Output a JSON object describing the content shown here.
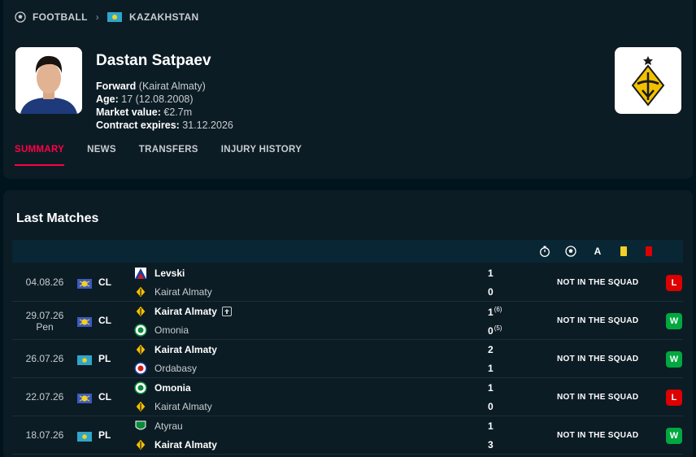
{
  "breadcrumb": {
    "sport": "FOOTBALL",
    "country": "KAZAKHSTAN"
  },
  "player": {
    "name": "Dastan Satpaev",
    "position_label": "Forward",
    "club_paren": "(Kairat Almaty)",
    "age_label": "Age:",
    "age_value": "17 (12.08.2008)",
    "market_label": "Market value:",
    "market_value": "€2.7m",
    "contract_label": "Contract expires:",
    "contract_value": "31.12.2026"
  },
  "tabs": [
    "SUMMARY",
    "NEWS",
    "TRANSFERS",
    "INJURY HISTORY"
  ],
  "matches": {
    "title": "Last Matches",
    "header_icons": [
      "stopwatch-icon",
      "ball-icon",
      "assist-icon",
      "yellow-card-icon",
      "red-card-icon"
    ],
    "header_assist_letter": "A",
    "rows": [
      {
        "date": "04.08.26",
        "note": "",
        "comp": "CL",
        "comp_flag": "europe",
        "home": "Levski",
        "home_bold": true,
        "home_score": "1",
        "home_pen": "",
        "home_logo": "levski",
        "away": "Kairat Almaty",
        "away_bold": false,
        "away_score": "0",
        "away_pen": "",
        "away_logo": "kairat",
        "status": "NOT IN THE SQUAD",
        "result": "L"
      },
      {
        "date": "29.07.26",
        "note": "Pen",
        "comp": "CL",
        "comp_flag": "europe",
        "home": "Kairat Almaty",
        "home_bold": true,
        "home_score": "1",
        "home_pen": "(6)",
        "home_logo": "kairat",
        "away": "Omonia",
        "away_bold": false,
        "away_score": "0",
        "away_pen": "(5)",
        "away_logo": "omonia",
        "status": "NOT IN THE SQUAD",
        "result": "W",
        "promoted": true
      },
      {
        "date": "26.07.26",
        "note": "",
        "comp": "PL",
        "comp_flag": "kazakhstan",
        "home": "Kairat Almaty",
        "home_bold": true,
        "home_score": "2",
        "home_pen": "",
        "home_logo": "kairat",
        "away": "Ordabasy",
        "away_bold": false,
        "away_score": "1",
        "away_pen": "",
        "away_logo": "ordabasy",
        "status": "NOT IN THE SQUAD",
        "result": "W"
      },
      {
        "date": "22.07.26",
        "note": "",
        "comp": "CL",
        "comp_flag": "europe",
        "home": "Omonia",
        "home_bold": true,
        "home_score": "1",
        "home_pen": "",
        "home_logo": "omonia",
        "away": "Kairat Almaty",
        "away_bold": false,
        "away_score": "0",
        "away_pen": "",
        "away_logo": "kairat",
        "status": "NOT IN THE SQUAD",
        "result": "L"
      },
      {
        "date": "18.07.26",
        "note": "",
        "comp": "PL",
        "comp_flag": "kazakhstan",
        "home": "Atyrau",
        "home_bold": false,
        "home_score": "1",
        "home_pen": "",
        "home_logo": "atyrau",
        "away": "Kairat Almaty",
        "away_bold": true,
        "away_score": "3",
        "away_pen": "",
        "away_logo": "kairat",
        "status": "NOT IN THE SQUAD",
        "result": "W"
      }
    ]
  },
  "colors": {
    "accent": "#ff0046",
    "win": "#00a83f",
    "loss": "#dc0000",
    "background": "#00141e",
    "card": "#0c1c25"
  }
}
